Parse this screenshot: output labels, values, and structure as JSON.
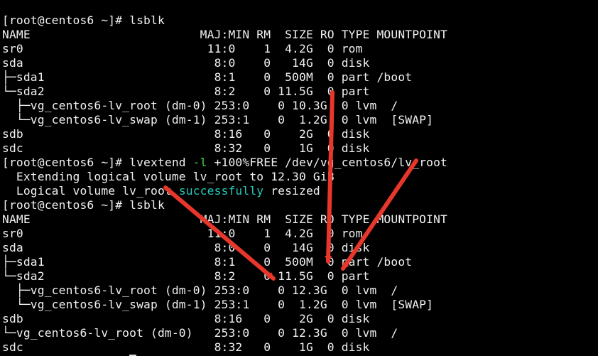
{
  "terminal": {
    "colors": {
      "background": "#000000",
      "foreground": "#f0f0f0",
      "flag": "#4ad04a",
      "success": "#28c8b8",
      "annotation_arrow": "#e8362a"
    },
    "prompt": "[root@centos6 ~]# ",
    "commands": {
      "lsblk_1": "lsblk",
      "lvextend_pre": "lvextend ",
      "lvextend_flag": "-l",
      "lvextend_post": " +100%FREE /dev/vg_centos6/lv_root",
      "lsblk_2": "lsblk"
    },
    "lsblk_header": "NAME                        MAJ:MIN RM  SIZE RO TYPE MOUNTPOINT",
    "lsblk_1_rows": [
      "sr0                          11:0    1  4.2G  0 rom",
      "sda                           8:0    0   14G  0 disk",
      "├─sda1                        8:1    0  500M  0 part /boot",
      "└─sda2                        8:2    0 11.5G  0 part",
      "  ├─vg_centos6-lv_root (dm-0) 253:0    0 10.3G  0 lvm  /",
      "  └─vg_centos6-lv_swap (dm-1) 253:1    0  1.2G  0 lvm  [SWAP]",
      "sdb                           8:16   0    2G  0 disk",
      "sdc                           8:32   0    1G  0 disk"
    ],
    "lvextend_output": {
      "line1": "  Extending logical volume lv_root to 12.30 GiB",
      "line2_pre": "  Logical volume lv_root ",
      "line2_success": "successfully",
      "line2_post": " resized"
    },
    "lsblk_2_rows": [
      "sr0                          11:0    1  4.2G  0 rom",
      "sda                           8:0    0   14G  0 disk",
      "├─sda1                        8:1    0  500M  0 part /boot",
      "└─sda2                        8:2    0 11.5G  0 part",
      "  ├─vg_centos6-lv_root (dm-0) 253:0    0 12.3G  0 lvm  /",
      "  └─vg_centos6-lv_swap (dm-1) 253:1    0  1.2G  0 lvm  [SWAP]",
      "sdb                           8:16   0    2G  0 disk",
      "└─vg_centos6-lv_root (dm-0)   253:0    0 12.3G  0 lvm  /",
      "sdc                           8:32   0    1G  0 disk"
    ]
  }
}
